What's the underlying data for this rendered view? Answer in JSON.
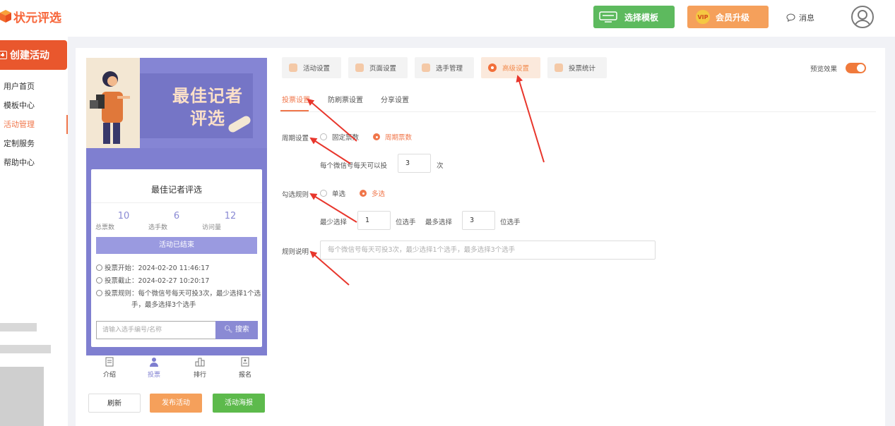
{
  "header": {
    "logo_text": "状元评选",
    "template_button": "选择模板",
    "vip_badge": "VIP",
    "vip_button": "会员升级",
    "message_label": "消息"
  },
  "sidebar": {
    "create_button": "创建活动",
    "items": [
      {
        "label": "用户首页"
      },
      {
        "label": "模板中心"
      },
      {
        "label": "活动管理"
      },
      {
        "label": "定制服务"
      },
      {
        "label": "帮助中心"
      }
    ]
  },
  "phone": {
    "banner_title_line1": "最佳记者",
    "banner_title_line2": "评选",
    "card_title": "最佳记者评选",
    "stats": [
      {
        "value": "10",
        "label": "总票数"
      },
      {
        "value": "6",
        "label": "选手数"
      },
      {
        "value": "12",
        "label": "访问量"
      }
    ],
    "status_button": "活动已结束",
    "vote_start": "投票开始：2024-02-20 11:46:17",
    "vote_end": "投票截止：2024-02-27 10:20:17",
    "vote_rule_line1": "投票规则：每个微信号每天可投3次，最少选择1个选",
    "vote_rule_line2": "手，最多选择3个选手",
    "search_placeholder": "请输入选手编号/名称",
    "search_button": "搜索",
    "tabs": [
      {
        "label": "介绍"
      },
      {
        "label": "投票"
      },
      {
        "label": "排行"
      },
      {
        "label": "报名"
      }
    ]
  },
  "actions": {
    "refresh": "刷新",
    "publish": "发布活动",
    "poster": "活动海报"
  },
  "settings": {
    "tabs": [
      {
        "label": "活动设置"
      },
      {
        "label": "页面设置"
      },
      {
        "label": "选手管理"
      },
      {
        "label": "高级设置"
      },
      {
        "label": "投票统计"
      }
    ],
    "preview_label": "预览效果",
    "subtabs": [
      {
        "label": "投票设置"
      },
      {
        "label": "防刷票设置"
      },
      {
        "label": "分享设置"
      }
    ],
    "cycle_label": "周期设置",
    "cycle_options": [
      {
        "label": "固定票数"
      },
      {
        "label": "周期票数"
      }
    ],
    "per_day_text": "每个微信号每天可以投",
    "per_day_value": "3",
    "per_day_unit": "次",
    "select_rule_label": "勾选规则",
    "select_options": [
      {
        "label": "单选"
      },
      {
        "label": "多选"
      }
    ],
    "min_label": "最少选择",
    "min_value": "1",
    "min_unit": "位选手",
    "max_label": "最多选择",
    "max_value": "3",
    "max_unit": "位选手",
    "rule_desc_label": "规则说明",
    "rule_desc_placeholder": "每个微信号每天可投3次，最少选择1个选手，最多选择3个选手"
  },
  "colors": {
    "brand_orange": "#f0764a",
    "green": "#5dba5e",
    "phone_purple": "#7f7fd0"
  }
}
